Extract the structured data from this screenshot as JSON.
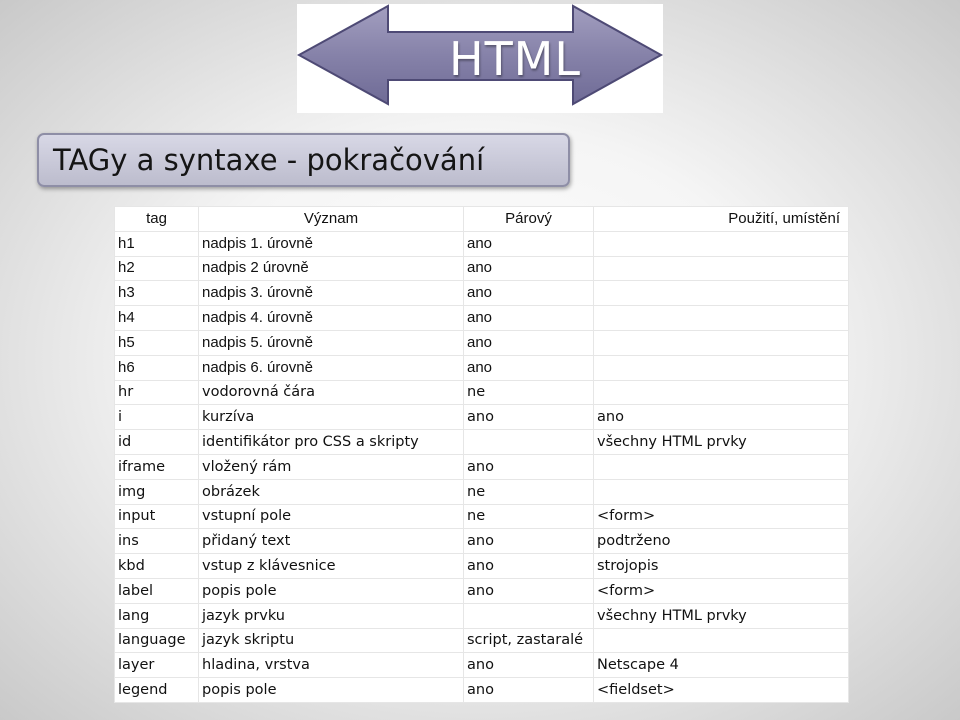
{
  "banner": {
    "label": "HTML"
  },
  "title": "TAGy a syntaxe - pokračování",
  "table": {
    "headers": [
      "tag",
      "Význam",
      "Párový",
      "Použití, umístění"
    ],
    "rows": [
      {
        "tag": "h1",
        "meaning": "nadpis 1. úrovně",
        "paired": "ano",
        "usage": ""
      },
      {
        "tag": "h2",
        "meaning": "nadpis 2 úrovně",
        "paired": "ano",
        "usage": ""
      },
      {
        "tag": "h3",
        "meaning": "nadpis 3. úrovně",
        "paired": "ano",
        "usage": ""
      },
      {
        "tag": "h4",
        "meaning": "nadpis 4. úrovně",
        "paired": "ano",
        "usage": ""
      },
      {
        "tag": "h5",
        "meaning": "nadpis 5. úrovně",
        "paired": "ano",
        "usage": ""
      },
      {
        "tag": "h6",
        "meaning": "nadpis 6. úrovně",
        "paired": "ano",
        "usage": ""
      },
      {
        "tag": "hr",
        "meaning": "vodorovná čára",
        "paired": "ne",
        "usage": ""
      },
      {
        "tag": "i",
        "meaning": "kurzíva",
        "paired": "ano",
        "usage": "ano"
      },
      {
        "tag": "id",
        "meaning": "identifikátor pro CSS a skripty",
        "paired": "",
        "usage": "všechny HTML prvky"
      },
      {
        "tag": "iframe",
        "meaning": "vložený rám",
        "paired": "ano",
        "usage": ""
      },
      {
        "tag": "img",
        "meaning": "obrázek",
        "paired": "ne",
        "usage": ""
      },
      {
        "tag": "input",
        "meaning": "vstupní pole",
        "paired": "ne",
        "usage": "<form>"
      },
      {
        "tag": "ins",
        "meaning": "přidaný text",
        "paired": "ano",
        "usage": "podtrženo"
      },
      {
        "tag": "kbd",
        "meaning": "vstup z klávesnice",
        "paired": "ano",
        "usage": "strojopis"
      },
      {
        "tag": "label",
        "meaning": "popis pole",
        "paired": "ano",
        "usage": "<form>"
      },
      {
        "tag": "lang",
        "meaning": "jazyk prvku",
        "paired": "",
        "usage": "všechny HTML prvky"
      },
      {
        "tag": "language",
        "meaning": "jazyk skriptu",
        "paired": "script, zastaralé",
        "usage": ""
      },
      {
        "tag": "layer",
        "meaning": "hladina, vrstva",
        "paired": "ano",
        "usage": "Netscape 4"
      },
      {
        "tag": "legend",
        "meaning": "popis pole",
        "paired": "ano",
        "usage": "<fieldset>"
      }
    ]
  }
}
